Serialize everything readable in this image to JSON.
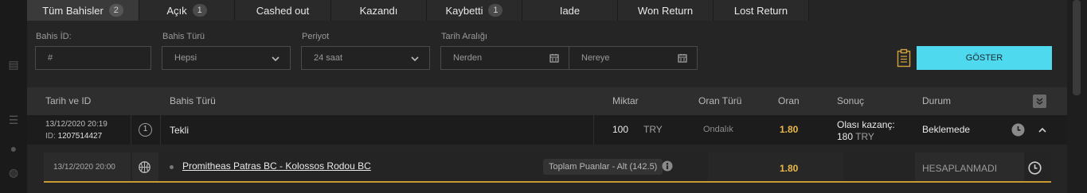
{
  "tabs": [
    {
      "label": "Tüm Bahisler",
      "count": "2",
      "active": true
    },
    {
      "label": "Açık",
      "count": "1"
    },
    {
      "label": "Cashed out"
    },
    {
      "label": "Kazandı"
    },
    {
      "label": "Kaybetti",
      "count": "1"
    },
    {
      "label": "Iade"
    },
    {
      "label": "Won Return"
    },
    {
      "label": "Lost Return"
    }
  ],
  "filters": {
    "bet_id": {
      "label": "Bahis İD:",
      "placeholder": "#"
    },
    "bet_type": {
      "label": "Bahis Türü",
      "value": "Hepsi"
    },
    "period": {
      "label": "Periyot",
      "value": "24 saat"
    },
    "date_range": {
      "label": "Tarih Aralığı",
      "from": "Nerden",
      "to": "Nereye"
    },
    "show_button": "GÖSTER"
  },
  "table": {
    "headers": {
      "date_id": "Tarih ve ID",
      "bet_type": "Bahis Türü",
      "amount": "Miktar",
      "odds_type": "Oran Türü",
      "odds": "Oran",
      "result": "Sonuç",
      "status": "Durum"
    },
    "bet": {
      "date": "13/12/2020 20:19",
      "id_label": "ID:",
      "id": "1207514427",
      "selections": "1",
      "type": "Tekli",
      "amount": "100",
      "currency": "TRY",
      "odds_type": "Ondalık",
      "odds": "1.80",
      "result_label": "Olası kazanç:",
      "result_value": "180",
      "result_currency": "TRY",
      "status": "Beklemede"
    },
    "selection": {
      "date": "13/12/2020 20:00",
      "sport_icon": "basketball-icon",
      "match": "Promitheas Patras BC - Kolossos Rodou BC",
      "market": "Toplam Puanlar - Alt (142.5)",
      "odds": "1.80",
      "status": "HESAPLANMADI"
    }
  },
  "colors": {
    "accent_button": "#4ed9ef",
    "odds": "#e8b84a",
    "row_underline": "#c99a32"
  }
}
